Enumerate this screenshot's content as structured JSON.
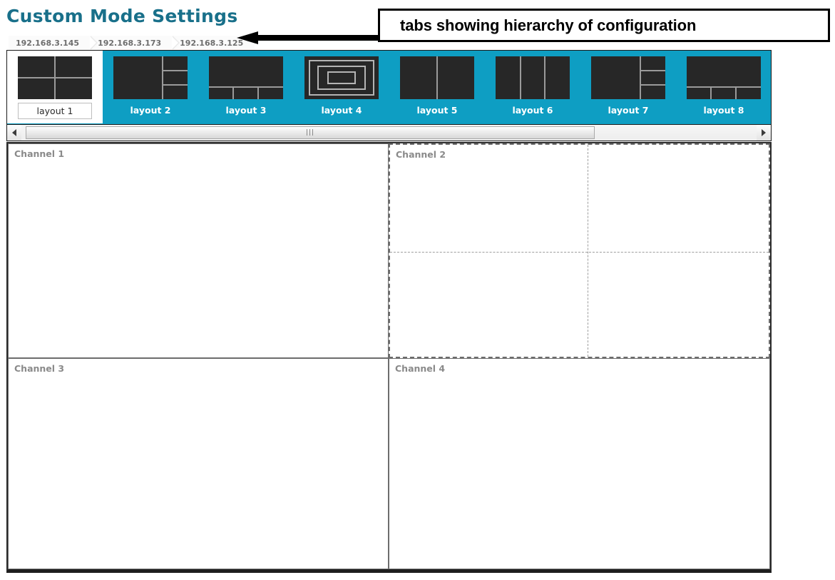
{
  "header": {
    "title": "Custom Mode Settings"
  },
  "breadcrumb": {
    "items": [
      {
        "label": "192.168.3.145"
      },
      {
        "label": "192.168.3.173"
      },
      {
        "label": "192.168.3.125"
      }
    ]
  },
  "annotation": {
    "text": "tabs showing hierarchy of configuration",
    "arrow_icon": "left-arrow-icon"
  },
  "layout_tabs": {
    "selected_index": 0,
    "accent_color": "#0e9ec3",
    "items": [
      {
        "label": "layout 1",
        "pattern": "grid-2x2"
      },
      {
        "label": "layout 2",
        "pattern": "left-large-3-right"
      },
      {
        "label": "layout 3",
        "pattern": "top-large-3-bottom"
      },
      {
        "label": "layout 4",
        "pattern": "nested-3"
      },
      {
        "label": "layout 5",
        "pattern": "cols-2"
      },
      {
        "label": "layout 6",
        "pattern": "cols-3"
      },
      {
        "label": "layout 7",
        "pattern": "left-large-3-right"
      },
      {
        "label": "layout 8",
        "pattern": "top-large-3-bottom"
      }
    ]
  },
  "scrollbar": {
    "left_arrow_icon": "triangle-left-icon",
    "right_arrow_icon": "triangle-right-icon",
    "grip_glyph": "|||"
  },
  "channels": [
    {
      "label": "Channel 1",
      "border": "solid"
    },
    {
      "label": "Channel 2",
      "border": "dashed"
    },
    {
      "label": "Channel 3",
      "border": "solid"
    },
    {
      "label": "Channel 4",
      "border": "solid"
    }
  ]
}
